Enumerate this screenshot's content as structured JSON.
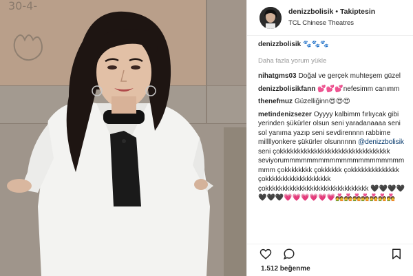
{
  "post": {
    "username": "denizzbolisik",
    "follow_status": "Takiptesin",
    "location": "TCL Chinese Theatres",
    "caption_user": "denizzbolisik",
    "caption_text": "🐾🐾🐾",
    "load_more": "Daha fazla yorum yükle",
    "likes": "1.512 beğenme"
  },
  "comments": [
    {
      "user": "nihatgms03",
      "text": "Doğal ve gerçek muhteşem güzel"
    },
    {
      "user": "denizzbolisikfann",
      "text": "💕💕💕nefesimm canımm"
    },
    {
      "user": "thenefmuz",
      "text": "Güzelliğinn😍😍😍"
    }
  ],
  "long_comment": {
    "user": "metindenizsezer",
    "text_before": "Oyyyy kalbimm fırlıycak gibi yerinden şükürler olsun seni yaradanaaaa seni sol yanıma yazıp seni sevdirennnn rabbime millllyonkere şükürler olsunnnnn",
    "mention": "@denizzbolisik",
    "text_after": "seni çokkkkkkkkkkkkkkkkkkkkkkkkkkkkkkkk seviyorummmmmmmmmmmmmmmmmmmmm mmm çokkkkkkkk çokkkkkk çokkkkkkkkkkkkkk çokkkkkkkkkkkkkkkkkkk çokkkkkkkkkkkkkkkkkkkkkkkkkkkkkk 🖤🖤🖤🖤🖤🖤🖤💗💗💗💗💗💗💑💑💑💑💑💑💑"
  },
  "icons": {
    "avatar": "profile-avatar",
    "like": "heart-icon",
    "comment": "comment-icon",
    "save": "bookmark-icon"
  },
  "colors": {
    "text": "#262626",
    "muted": "#999999",
    "mention": "#003569",
    "border": "#efefef"
  }
}
